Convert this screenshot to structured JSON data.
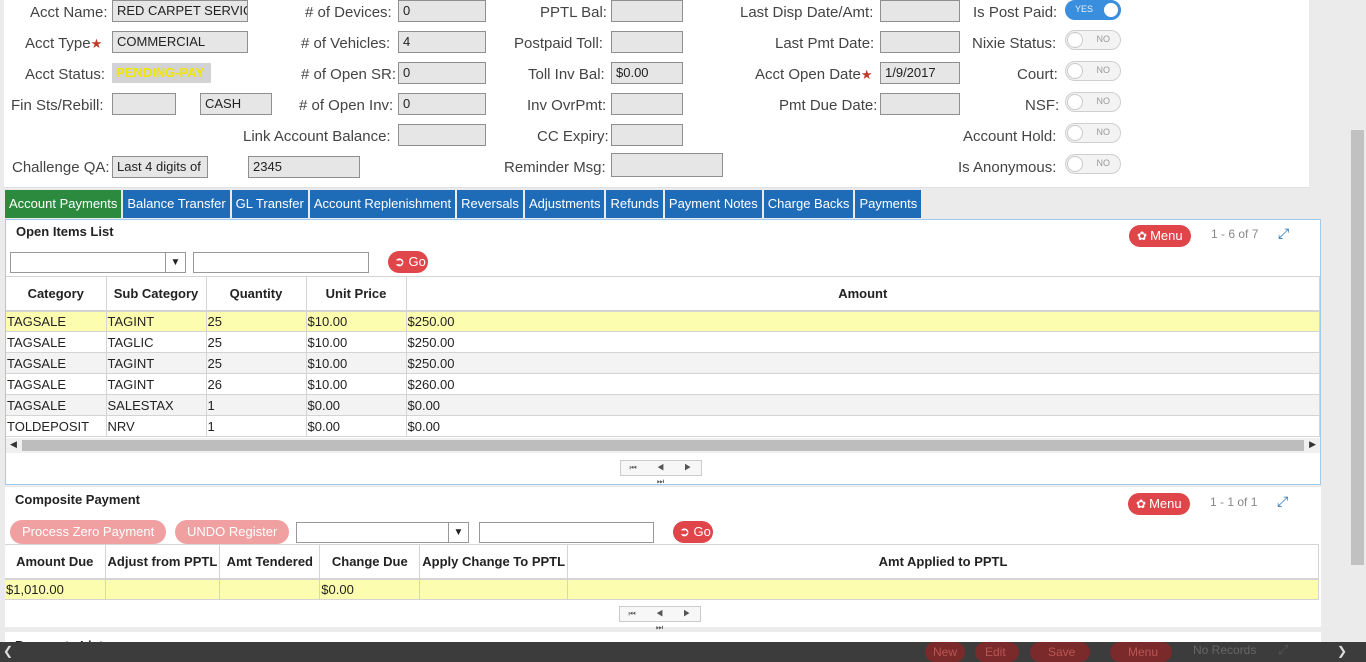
{
  "account": {
    "acct_name_label": "Acct Name:",
    "acct_name": "RED CARPET SERVICE",
    "acct_type_label": "Acct Type",
    "acct_type": "COMMERCIAL",
    "acct_status_label": "Acct Status:",
    "acct_status": "PENDING-PAY",
    "fin_sts_label": "Fin Sts/Rebill:",
    "fin_sts": "",
    "rebill": "CASH",
    "challenge_label": "Challenge QA:",
    "challenge_q": "Last 4 digits of",
    "challenge_a": "2345",
    "devices_label": "# of Devices:",
    "devices": "0",
    "vehicles_label": "# of Vehicles:",
    "vehicles": "4",
    "open_sr_label": "# of Open SR:",
    "open_sr": "0",
    "open_inv_label": "# of Open Inv:",
    "open_inv": "0",
    "link_bal_label": "Link Account Balance:",
    "link_bal": "",
    "pptl_bal_label": "PPTL Bal:",
    "pptl_bal": "",
    "postpaid_toll_label": "Postpaid Toll:",
    "postpaid_toll": "",
    "toll_inv_bal_label": "Toll Inv Bal:",
    "toll_inv_bal": "$0.00",
    "inv_ovrpmt_label": "Inv OvrPmt:",
    "inv_ovrpmt": "",
    "cc_expiry_label": "CC Expiry:",
    "cc_expiry": "",
    "reminder_label": "Reminder Msg:",
    "reminder": "",
    "last_disp_label": "Last Disp Date/Amt:",
    "last_disp": "",
    "last_pmt_label": "Last Pmt Date:",
    "last_pmt": "",
    "open_date_label": "Acct Open Date",
    "open_date": "1/9/2017",
    "pmt_due_label": "Pmt Due Date:",
    "pmt_due": "",
    "is_post_paid_label": "Is Post Paid:",
    "is_post_paid": "YES",
    "nixie_label": "Nixie Status:",
    "nixie": "NO",
    "court_label": "Court:",
    "court": "NO",
    "nsf_label": "NSF:",
    "nsf": "NO",
    "hold_label": "Account Hold:",
    "hold": "NO",
    "anon_label": "Is Anonymous:",
    "anon": "NO"
  },
  "tabs": [
    "Account Payments",
    "Balance Transfer",
    "GL Transfer",
    "Account Replenishment",
    "Reversals",
    "Adjustments",
    "Refunds",
    "Payment Notes",
    "Charge Backs",
    "Payments"
  ],
  "open_items": {
    "title": "Open Items List",
    "menu_label": "Menu",
    "paging": "1 - 6 of 7",
    "go_label": "Go",
    "columns": [
      "Category",
      "Sub Category",
      "Quantity",
      "Unit Price",
      "Amount"
    ],
    "rows": [
      [
        "TAGSALE",
        "TAGINT",
        "25",
        "$10.00",
        "$250.00"
      ],
      [
        "TAGSALE",
        "TAGLIC",
        "25",
        "$10.00",
        "$250.00"
      ],
      [
        "TAGSALE",
        "TAGINT",
        "25",
        "$10.00",
        "$250.00"
      ],
      [
        "TAGSALE",
        "TAGINT",
        "26",
        "$10.00",
        "$260.00"
      ],
      [
        "TAGSALE",
        "SALESTAX",
        "1",
        "$0.00",
        "$0.00"
      ],
      [
        "TOLDEPOSIT",
        "NRV",
        "1",
        "$0.00",
        "$0.00"
      ]
    ]
  },
  "composite": {
    "title": "Composite Payment",
    "menu_label": "Menu",
    "paging": "1 - 1 of 1",
    "process_zero_label": "Process Zero Payment",
    "undo_label": "UNDO Register",
    "go_label": "Go",
    "columns": [
      "Amount Due",
      "Adjust from PPTL",
      "Amt Tendered",
      "Change Due",
      "Apply Change To PPTL",
      "Amt Applied to PPTL"
    ],
    "rows": [
      [
        "$1,010.00",
        "",
        "",
        "$0.00",
        "",
        ""
      ]
    ]
  },
  "payments_list": {
    "title": "Payments List",
    "new_label": "New",
    "edit_label": "Edit",
    "save_label": "Save",
    "menu_label": "Menu",
    "status": "No Records"
  },
  "pager_icons": "⏮ ◀ ▶ ⏭",
  "colors": {
    "tab_blue": "#1e6bb8",
    "tab_active_green": "#2c8a3e",
    "button_red": "#e0454a",
    "selected_row_yellow": "#fdfdb0",
    "toggle_on_blue": "#3a8ede"
  }
}
